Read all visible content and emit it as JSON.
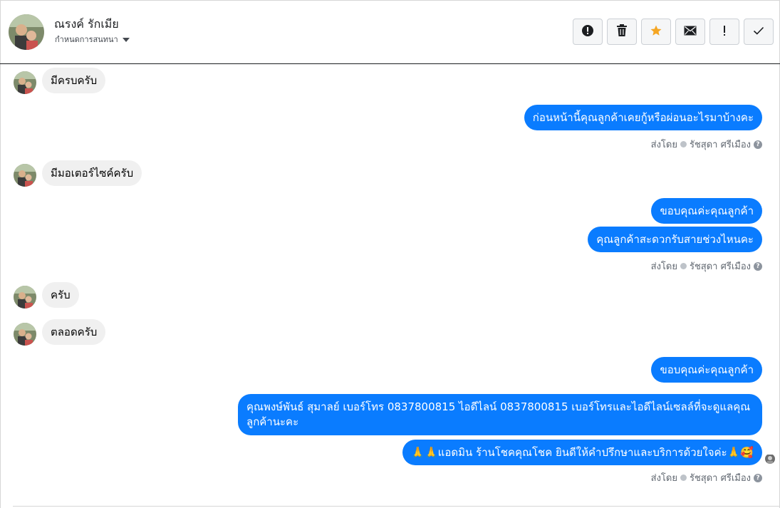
{
  "header": {
    "contact_name": "ณรงค์ รักเมีย",
    "assign_label": "กำหนดการสนทนา",
    "toolbar": [
      {
        "icon": "alert-circle-icon"
      },
      {
        "icon": "trash-icon"
      },
      {
        "icon": "star-icon"
      },
      {
        "icon": "mail-icon"
      },
      {
        "icon": "exclamation-icon"
      },
      {
        "icon": "check-icon"
      }
    ]
  },
  "messages": {
    "m1": "มีครบครับ",
    "m2": "ก่อนหน้านี้คุณลูกค้าเคยกู้หรือผ่อนอะไรมาบ้างคะ",
    "m3": "มีมอเตอร์ไซค์ครับ",
    "m4": "ขอบคุณค่ะคุณลูกค้า",
    "m5": "คุณลูกค้าสะดวกรับสายช่วงไหนคะ",
    "m6": "ครับ",
    "m7": "ตลอดครับ",
    "m8": "ขอบคุณค่ะคุณลูกค้า",
    "m9": "คุณพงษ์พันธ์ สุมาลย์      เบอร์โทร 0837800815  ไอดีไลน์ 0837800815   เบอร์โทรและไอดีไลน์เซลล์ที่จะดูแลคุณลูกค้านะคะ",
    "m10": "🙏🙏แอดมิน ร้านโชคคุณโชค ยินดีให้คำปรึกษาและบริการด้วยใจค่ะ🙏🥰"
  },
  "sent_by": {
    "label": "ส่งโดย",
    "agent": "รัชสุดา ศรีเมือง"
  },
  "colors": {
    "outgoing": "#0a7cff",
    "incoming": "#f0f0f0",
    "star": "#f5a623"
  }
}
